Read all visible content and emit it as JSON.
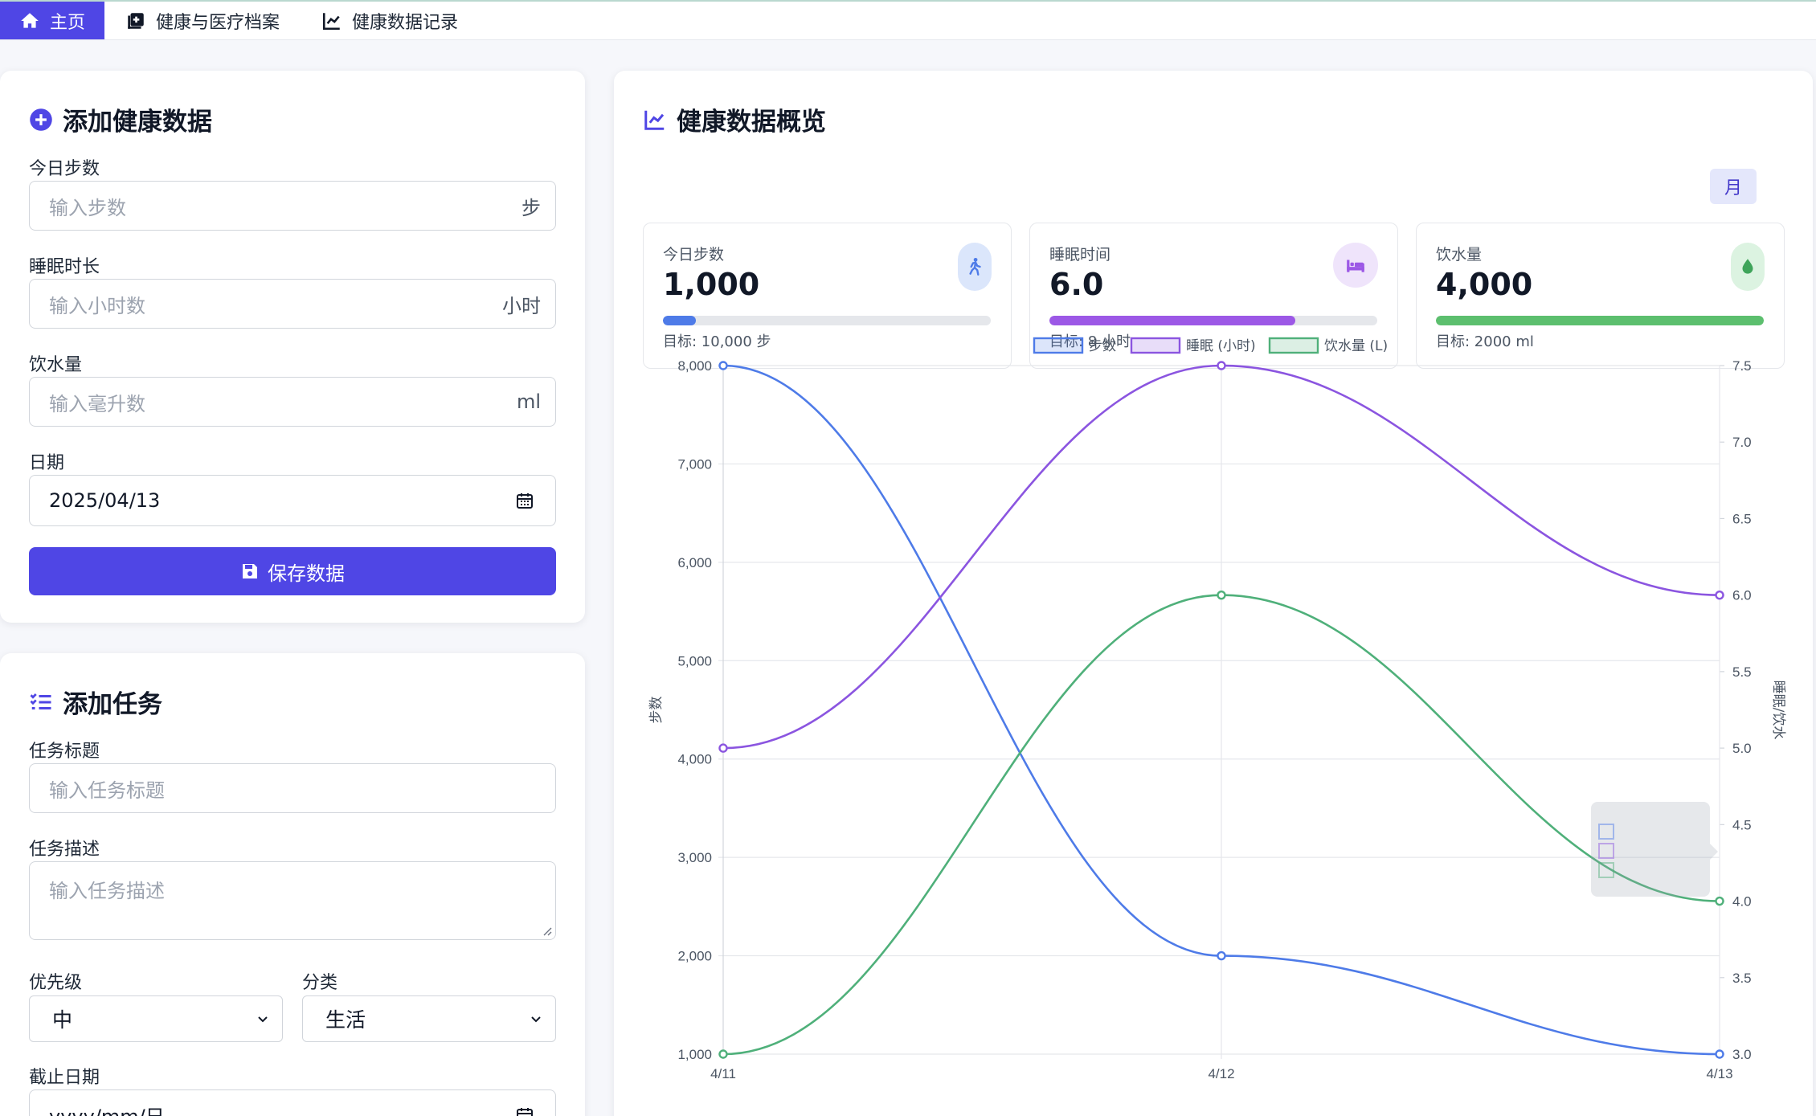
{
  "nav": {
    "items": [
      {
        "label": "主页",
        "icon": "home-icon",
        "active": true
      },
      {
        "label": "健康与医疗档案",
        "icon": "medical-record-icon",
        "active": false
      },
      {
        "label": "健康数据记录",
        "icon": "line-chart-icon",
        "active": false
      }
    ]
  },
  "health_form": {
    "title": "添加健康数据",
    "steps_label": "今日步数",
    "steps_placeholder": "输入步数",
    "steps_unit": "步",
    "sleep_label": "睡眠时长",
    "sleep_placeholder": "输入小时数",
    "sleep_unit": "小时",
    "water_label": "饮水量",
    "water_placeholder": "输入毫升数",
    "water_unit": "ml",
    "date_label": "日期",
    "date_value": "2025/04/13",
    "save_label": "保存数据"
  },
  "task_form": {
    "title": "添加任务",
    "title_label": "任务标题",
    "title_placeholder": "输入任务标题",
    "desc_label": "任务描述",
    "desc_placeholder": "输入任务描述",
    "priority_label": "优先级",
    "priority_value": "中",
    "category_label": "分类",
    "category_value": "生活",
    "due_label": "截止日期",
    "due_placeholder": "yyyy/mm/日"
  },
  "overview": {
    "title": "健康数据概览",
    "period": "月",
    "stats": [
      {
        "label": "今日步数",
        "value": "1,000",
        "goal": "目标: 10,000 步",
        "progress": 0.1,
        "color": "#4e7be8",
        "icon": "walking-icon",
        "icon_bg": "#dbe6fb"
      },
      {
        "label": "睡眠时间",
        "value": "6.0",
        "goal": "目标: 8 小时",
        "progress": 0.75,
        "color": "#9c58e6",
        "icon": "bed-icon",
        "icon_bg": "#efe4fb"
      },
      {
        "label": "饮水量",
        "value": "4,000",
        "goal": "目标: 2000 ml",
        "progress": 1.0,
        "color": "#5cbf6e",
        "icon": "water-drop-icon",
        "icon_bg": "#dcf3e1"
      }
    ]
  },
  "chart_data": {
    "type": "line",
    "x": [
      "4/11",
      "4/12",
      "4/13"
    ],
    "series": [
      {
        "name": "步数",
        "axis": "left",
        "values": [
          8000,
          2000,
          1000
        ],
        "color": "#4e7be8"
      },
      {
        "name": "睡眠 (小时)",
        "axis": "right",
        "values": [
          5.0,
          7.5,
          6.0
        ],
        "color": "#8b55e0"
      },
      {
        "name": "饮水量 (L)",
        "axis": "right",
        "values": [
          3.0,
          6.0,
          4.0
        ],
        "color": "#4fb07a"
      }
    ],
    "ylabel": "步数",
    "ylabel_right": "睡眠/饮水",
    "ylim": [
      1000,
      8000
    ],
    "ylim_right": [
      3.0,
      7.5
    ],
    "yticks": [
      "1,000",
      "2,000",
      "3,000",
      "4,000",
      "5,000",
      "6,000",
      "7,000",
      "8,000"
    ],
    "yticks_right": [
      "3.0",
      "3.5",
      "4.0",
      "4.5",
      "5.0",
      "5.5",
      "6.0",
      "6.5",
      "7.0",
      "7.5"
    ],
    "grid": true,
    "legend": "top-center"
  }
}
